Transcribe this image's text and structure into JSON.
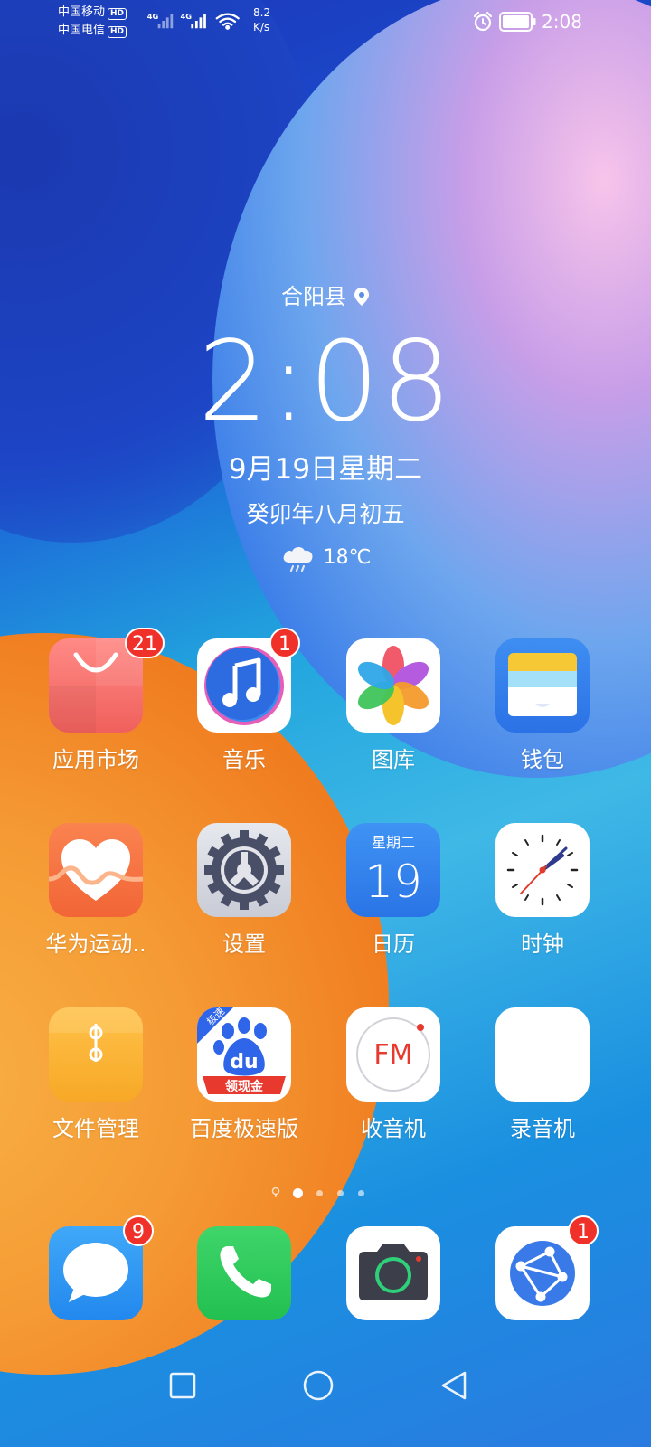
{
  "status_bar": {
    "carrier1": "中国移动",
    "carrier2": "中国电信",
    "hd_badge": "HD",
    "net1": "4G",
    "net2": "4G",
    "speed_value": "8.2",
    "speed_unit": "K/s",
    "time": "2:08",
    "battery_icon": "battery-full-icon",
    "alarm_icon": "alarm-icon"
  },
  "widget": {
    "location": "合阳县",
    "time": "2:08",
    "date": "9月19日星期二",
    "lunar": "癸卯年八月初五",
    "temperature": "18℃",
    "weather_icon": "rain-cloud-icon"
  },
  "apps": [
    {
      "label": "应用市场",
      "badge": "21",
      "icon": "app-market-icon"
    },
    {
      "label": "音乐",
      "badge": "1",
      "icon": "music-icon"
    },
    {
      "label": "图库",
      "badge": "",
      "icon": "gallery-icon"
    },
    {
      "label": "钱包",
      "badge": "",
      "icon": "wallet-icon"
    },
    {
      "label": "华为运动..",
      "badge": "",
      "icon": "health-icon"
    },
    {
      "label": "设置",
      "badge": "",
      "icon": "settings-icon"
    },
    {
      "label": "日历",
      "badge": "",
      "icon": "calendar-icon",
      "calendar_weekday": "星期二",
      "calendar_day": "19"
    },
    {
      "label": "时钟",
      "badge": "",
      "icon": "clock-icon"
    },
    {
      "label": "文件管理",
      "badge": "",
      "icon": "files-icon"
    },
    {
      "label": "百度极速版",
      "badge": "",
      "icon": "baidu-icon",
      "icon_text_top": "极速",
      "icon_text_mid": "du",
      "icon_text_bottom": "领现金"
    },
    {
      "label": "收音机",
      "badge": "",
      "icon": "radio-icon",
      "icon_text": "FM"
    },
    {
      "label": "录音机",
      "badge": "",
      "icon": "recorder-icon"
    }
  ],
  "page_indicator": {
    "pages": 4,
    "active": 1
  },
  "dock": [
    {
      "badge": "9",
      "icon": "messages-icon"
    },
    {
      "badge": "",
      "icon": "phone-icon"
    },
    {
      "badge": "",
      "icon": "camera-icon"
    },
    {
      "badge": "1",
      "icon": "browser-icon"
    }
  ],
  "nav_bar": {
    "recent": "square-recent-icon",
    "home": "circle-home-icon",
    "back": "triangle-back-icon"
  }
}
